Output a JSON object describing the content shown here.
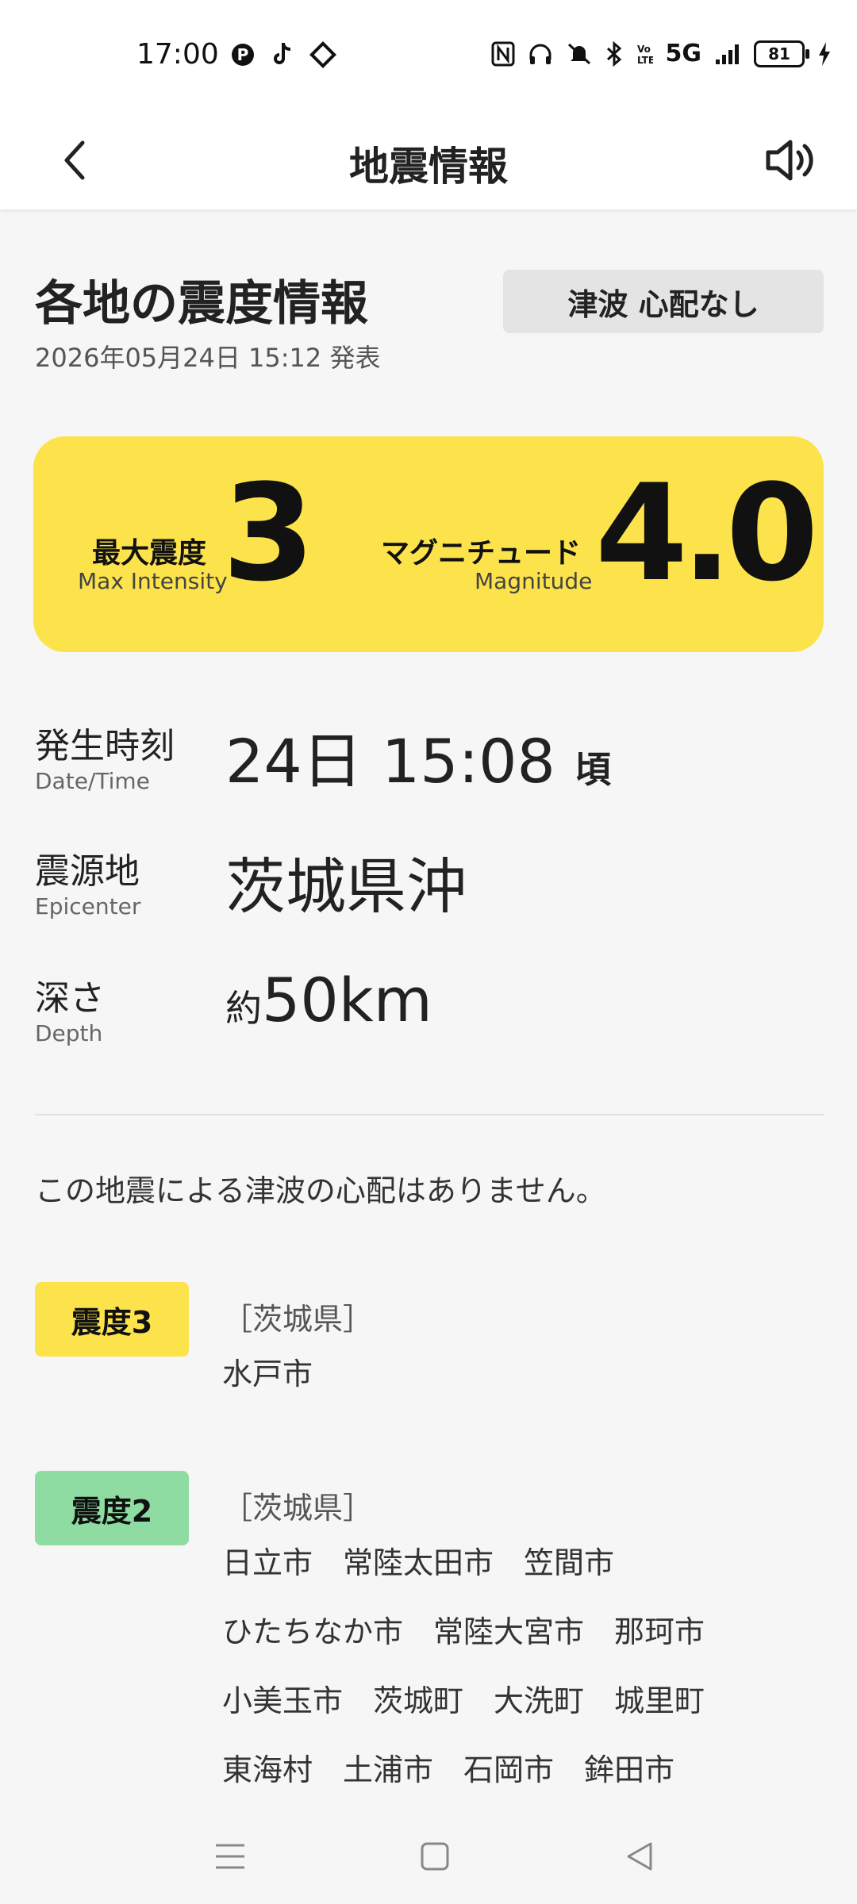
{
  "status": {
    "time": "17:00",
    "network": "5G",
    "battery": "81"
  },
  "appbar": {
    "title": "地震情報"
  },
  "header": {
    "title": "各地の震度情報",
    "announced": "2026年05月24日 15:12 発表",
    "tsunami_badge": "津波 心配なし"
  },
  "summary": {
    "max_intensity_label_jp": "最大震度",
    "max_intensity_label_en": "Max Intensity",
    "max_intensity_value": "3",
    "magnitude_label_jp": "マグニチュード",
    "magnitude_label_en": "Magnitude",
    "magnitude_value": "4.0"
  },
  "details": {
    "datetime": {
      "label_jp": "発生時刻",
      "label_en": "Date/Time",
      "value": "24日 15:08",
      "suffix": "頃"
    },
    "epicenter": {
      "label_jp": "震源地",
      "label_en": "Epicenter",
      "value": "茨城県沖"
    },
    "depth": {
      "label_jp": "深さ",
      "label_en": "Depth",
      "prefix": "約",
      "value": "50km"
    }
  },
  "tsunami_message": "この地震による津波の心配はありません。",
  "intensities": [
    {
      "label": "震度3",
      "color": "#fde34b",
      "prefecture": "［茨城県］",
      "cities": [
        [
          "水戸市"
        ]
      ]
    },
    {
      "label": "震度2",
      "color": "#8fdca3",
      "prefecture": "［茨城県］",
      "cities": [
        [
          "日立市",
          "常陸太田市",
          "笠間市"
        ],
        [
          "ひたちなか市",
          "常陸大宮市",
          "那珂市"
        ],
        [
          "小美玉市",
          "茨城町",
          "大洗町",
          "城里町"
        ],
        [
          "東海村",
          "土浦市",
          "石岡市",
          "鉾田市"
        ]
      ]
    }
  ],
  "colors": {
    "accent_yellow": "#fde34b",
    "intensity2_green": "#8fdca3"
  }
}
